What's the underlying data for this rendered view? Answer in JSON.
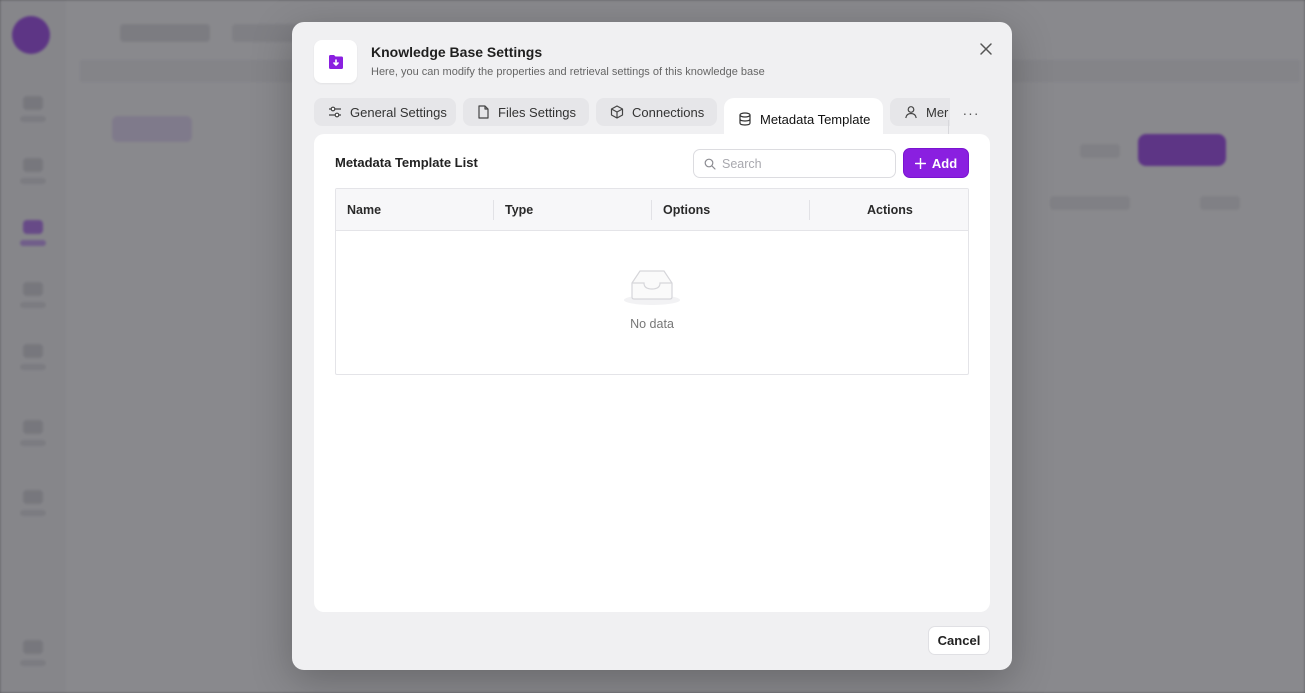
{
  "dialog": {
    "title": "Knowledge Base Settings",
    "subtitle": "Here, you can modify the properties and retrieval settings of this knowledge base",
    "icon": "knowledge-base-icon",
    "accent_color": "#8a1fe0"
  },
  "tabs": [
    {
      "label": "General Settings",
      "icon": "sliders-icon"
    },
    {
      "label": "Files Settings",
      "icon": "file-icon"
    },
    {
      "label": "Connections",
      "icon": "cube-icon"
    },
    {
      "label": "Metadata Template",
      "icon": "database-icon",
      "active": true
    },
    {
      "label": "Mer",
      "icon": "user-icon"
    }
  ],
  "more_label": "···",
  "panel": {
    "title": "Metadata Template List",
    "search_placeholder": "Search",
    "add_label": "Add"
  },
  "table": {
    "columns": [
      "Name",
      "Type",
      "Options",
      "Actions"
    ],
    "rows": [],
    "empty_text": "No data"
  },
  "footer": {
    "cancel_label": "Cancel"
  }
}
